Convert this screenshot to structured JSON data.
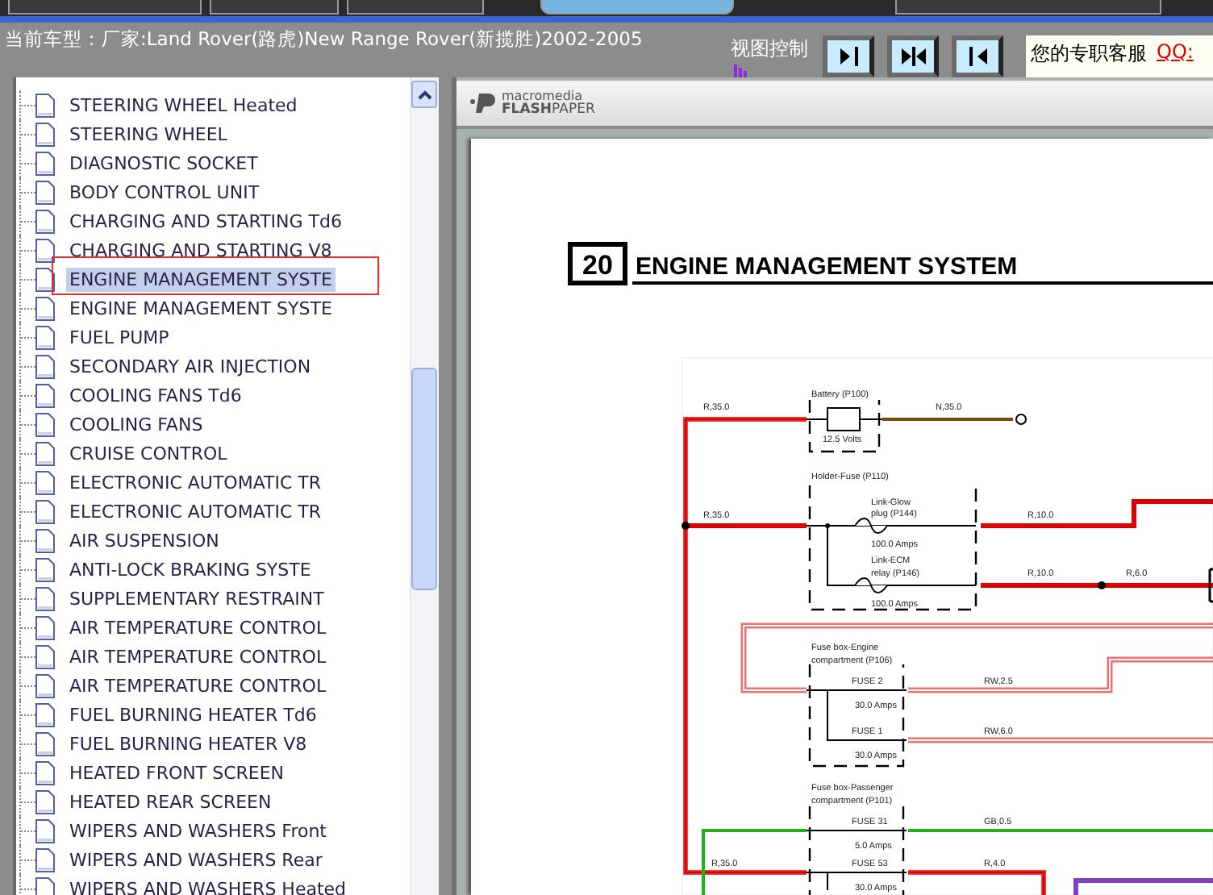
{
  "header": {
    "vehicle": "当前车型：厂家:Land Rover(路虎)New Range Rover(新揽胜)2002-2005",
    "view_control_label": "视图控制",
    "view_buttons": [
      {
        "kind": "right"
      },
      {
        "kind": "split"
      },
      {
        "kind": "left"
      }
    ],
    "support": {
      "label": "您的专职客服",
      "link": "QQ:"
    }
  },
  "tree": {
    "items": [
      {
        "label": "STEERING WHEEL Heated",
        "selected": false
      },
      {
        "label": "STEERING WHEEL",
        "selected": false
      },
      {
        "label": "DIAGNOSTIC SOCKET",
        "selected": false
      },
      {
        "label": "BODY CONTROL UNIT",
        "selected": false
      },
      {
        "label": "CHARGING AND STARTING Td6",
        "selected": false
      },
      {
        "label": "CHARGING AND STARTING V8",
        "selected": false
      },
      {
        "label": "ENGINE MANAGEMENT SYSTE",
        "selected": true
      },
      {
        "label": "ENGINE MANAGEMENT SYSTE",
        "selected": false
      },
      {
        "label": "FUEL PUMP",
        "selected": false
      },
      {
        "label": "SECONDARY AIR INJECTION",
        "selected": false
      },
      {
        "label": "COOLING FANS Td6",
        "selected": false
      },
      {
        "label": "COOLING FANS",
        "selected": false
      },
      {
        "label": "CRUISE CONTROL",
        "selected": false
      },
      {
        "label": "ELECTRONIC AUTOMATIC TR",
        "selected": false
      },
      {
        "label": "ELECTRONIC AUTOMATIC TR",
        "selected": false
      },
      {
        "label": "AIR SUSPENSION",
        "selected": false
      },
      {
        "label": "ANTI-LOCK BRAKING SYSTE",
        "selected": false
      },
      {
        "label": "SUPPLEMENTARY RESTRAINT",
        "selected": false
      },
      {
        "label": "AIR TEMPERATURE CONTROL",
        "selected": false
      },
      {
        "label": "AIR TEMPERATURE CONTROL",
        "selected": false
      },
      {
        "label": "AIR TEMPERATURE CONTROL",
        "selected": false
      },
      {
        "label": "FUEL BURNING HEATER Td6",
        "selected": false
      },
      {
        "label": "FUEL BURNING HEATER V8",
        "selected": false
      },
      {
        "label": "HEATED FRONT SCREEN",
        "selected": false
      },
      {
        "label": "HEATED REAR SCREEN",
        "selected": false
      },
      {
        "label": "WIPERS AND WASHERS Front",
        "selected": false
      },
      {
        "label": "WIPERS AND WASHERS Rear",
        "selected": false
      },
      {
        "label": "WIPERS AND WASHERS Heated",
        "selected": false
      }
    ]
  },
  "viewer": {
    "logo": {
      "brand": "macromedia",
      "product_bold": "FLASH",
      "product_light": "PAPER"
    },
    "page": {
      "chapter_number": "20",
      "chapter_title": "ENGINE MANAGEMENT SYSTEM",
      "diagram_labels": [
        "R,35.0",
        "Battery (P100)",
        "12.5 Volts",
        "N,35.0",
        "R,35.0",
        "Holder-Fuse (P110)",
        "Link-Glow",
        "plug (P144)",
        "100.0 Amps",
        "Link-ECM",
        "relay (P146)",
        "100.0 Amps",
        "R,10.0",
        "R,10.0",
        "R,6.0",
        "Fuse box-Engine",
        "compartment (P106)",
        "FUSE 2",
        "30.0 Amps",
        "FUSE 1",
        "30.0 Amps",
        "RW,2.5",
        "RW,6.0",
        "Fuse box-Passenger",
        "compartment (P101)",
        "FUSE 31",
        "5.0 Amps",
        "GB,0.5",
        "R,35.0",
        "FUSE 53",
        "R,4.0",
        "30.0 Amps"
      ]
    }
  }
}
